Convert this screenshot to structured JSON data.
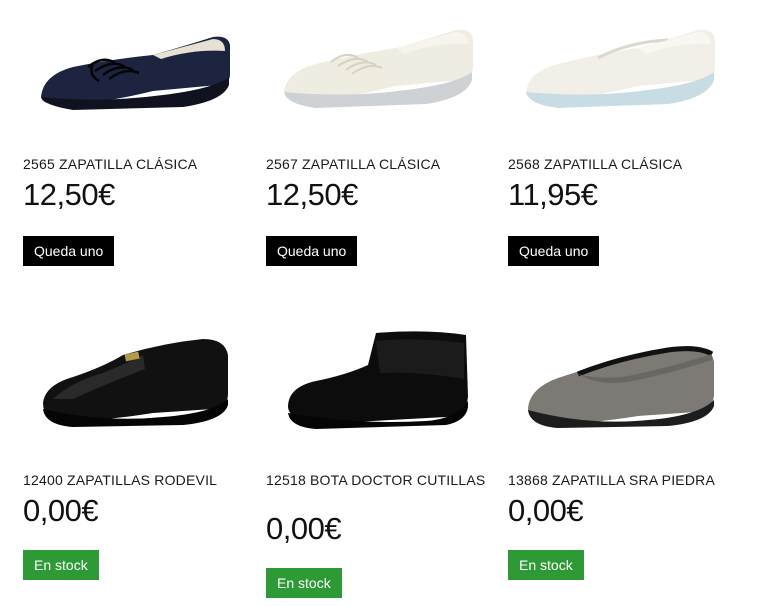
{
  "products": [
    {
      "name": "2565 ZAPATILLA CLÁSICA",
      "price": "12,50€",
      "stock_label": "Queda uno",
      "stock_color": "#000000",
      "image": "navy-lace-up-wedge-shoe"
    },
    {
      "name": "2567 ZAPATILLA CLÁSICA",
      "price": "12,50€",
      "stock_label": "Queda uno",
      "stock_color": "#000000",
      "image": "white-lace-up-wedge-shoe"
    },
    {
      "name": "2568 ZAPATILLA CLÁSICA",
      "price": "11,95€",
      "stock_label": "Queda uno",
      "stock_color": "#000000",
      "image": "white-slip-on-wedge-shoe"
    },
    {
      "name": "12400 ZAPATILLAS RODEVIL",
      "price": "0,00€",
      "stock_label": "En stock",
      "stock_color": "#2e9a35",
      "image": "black-loafer-slipper"
    },
    {
      "name": "12518 BOTA DOCTOR CUTILLAS",
      "price": "0,00€",
      "stock_label": "En stock",
      "stock_color": "#2e9a35",
      "image": "black-velcro-ankle-boot"
    },
    {
      "name": "13868 ZAPATILLA SRA PIEDRA",
      "price": "0,00€",
      "stock_label": "En stock",
      "stock_color": "#2e9a35",
      "image": "grey-ballet-flat-slipper"
    }
  ]
}
